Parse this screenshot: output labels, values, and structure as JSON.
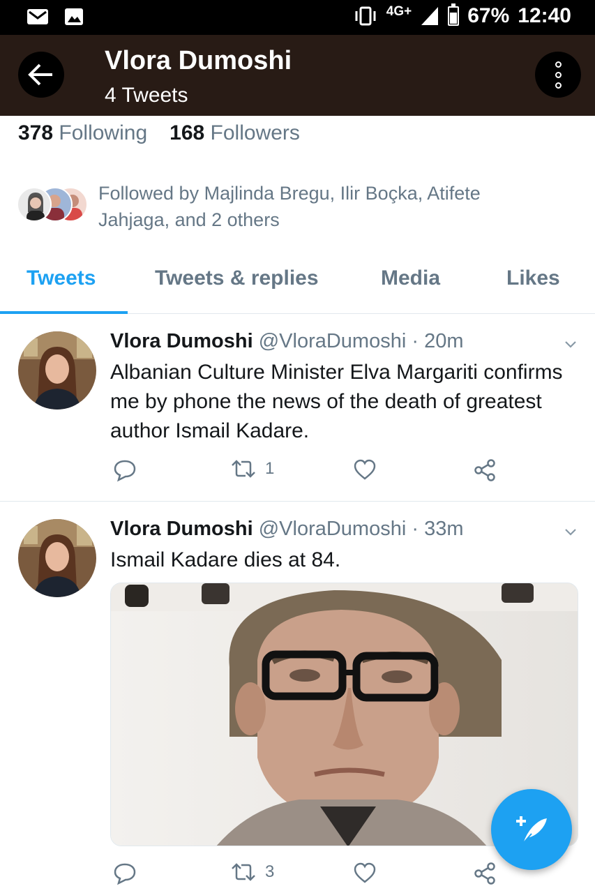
{
  "status_bar": {
    "network": "4G+",
    "battery": "67%",
    "time": "12:40",
    "icons": [
      "mail-icon",
      "image-icon",
      "vibrate-icon",
      "signal-icon",
      "battery-icon"
    ]
  },
  "header": {
    "name": "Vlora Dumoshi",
    "tweet_count": "4 Tweets"
  },
  "profile": {
    "following_count": "378",
    "following_label": "Following",
    "followers_count": "168",
    "followers_label": "Followers",
    "followed_by": "Followed by Majlinda Bregu, Ilir Boçka, Atifete Jahjaga, and 2 others"
  },
  "tabs": [
    {
      "label": "Tweets",
      "active": true
    },
    {
      "label": "Tweets & replies",
      "active": false
    },
    {
      "label": "Media",
      "active": false
    },
    {
      "label": "Likes",
      "active": false
    }
  ],
  "tweets": [
    {
      "name": "Vlora Dumoshi",
      "handle": "@VloraDumoshi",
      "time": "· 20m",
      "text": "Albanian Culture Minister Elva Margariti confirms me by phone the news of the death of greatest author Ismail Kadare.",
      "retweets": "1"
    },
    {
      "name": "Vlora Dumoshi",
      "handle": "@VloraDumoshi",
      "time": "· 33m",
      "text": "Ismail Kadare dies at 84.",
      "retweets": "3"
    }
  ],
  "colors": {
    "accent": "#1da1f2",
    "header_bg": "#281b15",
    "muted": "#657786"
  }
}
